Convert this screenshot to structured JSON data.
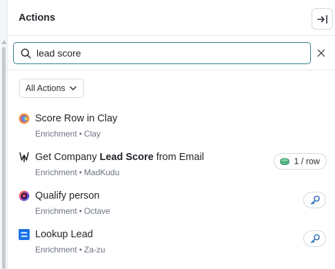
{
  "header": {
    "title": "Actions"
  },
  "search": {
    "value": "lead score"
  },
  "filter": {
    "label": "All Actions"
  },
  "items": [
    {
      "name": "Score Row in Clay",
      "category": "Enrichment",
      "provider": "Clay"
    },
    {
      "name_pre": "Get Company ",
      "name_bold": "Lead Score",
      "name_post": " from Email",
      "category": "Enrichment",
      "provider": "MadKudu",
      "badge": "1 / row"
    },
    {
      "name": "Qualify person",
      "category": "Enrichment",
      "provider": "Octave"
    },
    {
      "name": "Lookup Lead",
      "category": "Enrichment",
      "provider": "Za-zu"
    }
  ],
  "colors": {
    "search_border": "#2f7f8f",
    "key_icon": "#2f6fb5",
    "zazu_brand": "#1a73e8"
  }
}
